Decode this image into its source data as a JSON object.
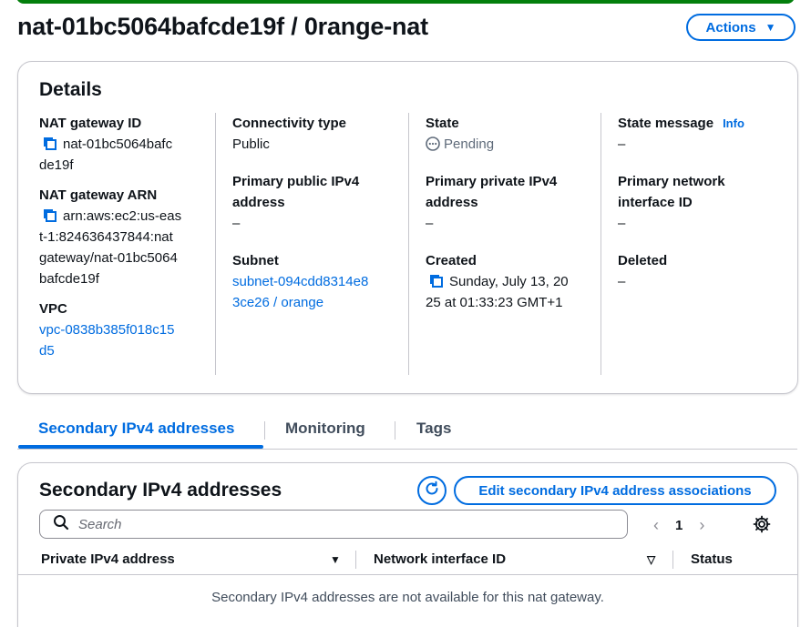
{
  "header": {
    "title": "nat-01bc5064bafcde19f / 0range-nat",
    "actions_label": "Actions",
    "banner_color": "#037f0c"
  },
  "details": {
    "title": "Details",
    "nat_gateway_id_label": "NAT gateway ID",
    "nat_gateway_id_lines": [
      "nat-01bc5064bafc",
      "de19f"
    ],
    "nat_gateway_arn_label": "NAT gateway ARN",
    "nat_gateway_arn_lines": [
      "arn:aws:ec2:us-eas",
      "t-1:824636437844:nat",
      "gateway/nat-01bc5064",
      "bafcde19f"
    ],
    "vpc_label": "VPC",
    "vpc_lines": [
      "vpc-0838b385f018c15",
      "d5"
    ],
    "connectivity_type_label": "Connectivity type",
    "connectivity_type_value": "Public",
    "primary_public_ipv4_label_lines": [
      "Primary public IPv4",
      "address"
    ],
    "primary_public_ipv4_value": "–",
    "subnet_label": "Subnet",
    "subnet_lines": [
      "subnet-094cdd8314e8",
      "3ce26 / orange"
    ],
    "state_label": "State",
    "state_value": "Pending",
    "primary_private_ipv4_label_lines": [
      "Primary private IPv4",
      "address"
    ],
    "primary_private_ipv4_value": "–",
    "created_label": "Created",
    "created_lines": [
      "Sunday, July 13, 20",
      "25 at 01:33:23 GMT+1"
    ],
    "state_message_label": "State message",
    "info_label": "Info",
    "state_message_value": "–",
    "primary_eni_label_lines": [
      "Primary network",
      "interface ID"
    ],
    "primary_eni_value": "–",
    "deleted_label": "Deleted",
    "deleted_value": "–"
  },
  "tabs": [
    {
      "label": "Secondary IPv4 addresses",
      "active": true
    },
    {
      "label": "Monitoring",
      "active": false
    },
    {
      "label": "Tags",
      "active": false
    }
  ],
  "secondary": {
    "title": "Secondary IPv4 addresses",
    "edit_label": "Edit secondary IPv4 address associations",
    "search_placeholder": "Search",
    "page_number": "1",
    "columns": [
      "Private IPv4 address",
      "Network interface ID",
      "Status"
    ],
    "empty_message": "Secondary IPv4 addresses are not available for this nat gateway."
  },
  "colors": {
    "accent": "#006ce0",
    "border": "#c6c6cd",
    "text": "#0f141a",
    "muted": "#5f6b7a"
  }
}
